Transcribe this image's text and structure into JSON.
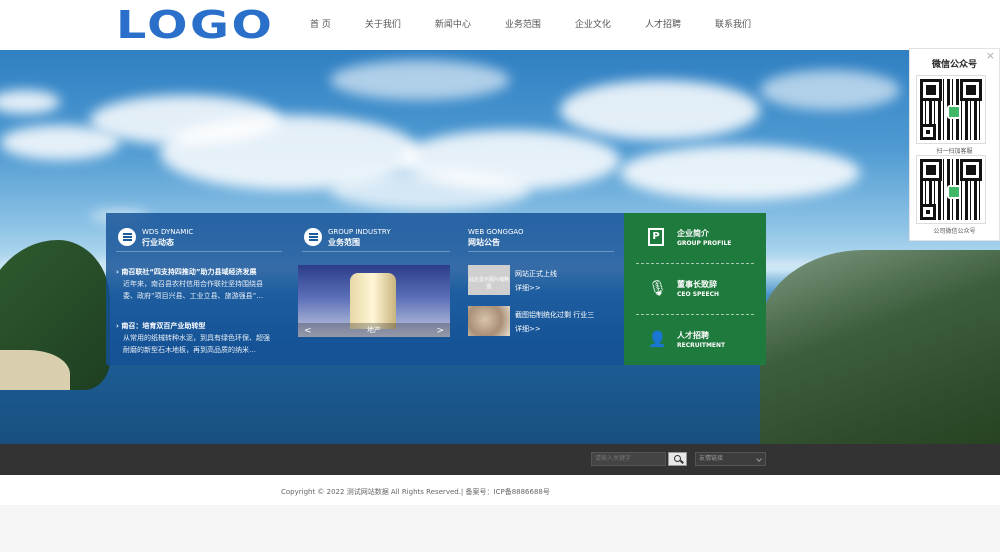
{
  "header": {
    "logo": "LOGO",
    "nav": [
      "首 页",
      "关于我们",
      "新闻中心",
      "业务范围",
      "企业文化",
      "人才招聘",
      "联系我们"
    ]
  },
  "panel": {
    "dynamic": {
      "en": "WDS DYNAMIC",
      "cn": "行业动态",
      "items": [
        {
          "title": "南召联社“四支持四推动”助力县域经济发展",
          "body": "近年来，南召县农村信用合作联社坚持围绕县委、政府“项目兴县、工业立县、旅游强县”…"
        },
        {
          "title": "南召：培育双百产业助转型",
          "body": "从常用的纸械转种水泥，到具有绿色环保、超强耐磨的新型石木地板，再到高品质的纳米…"
        }
      ]
    },
    "industry": {
      "en": "GROUP INDUSTRY",
      "cn": "业务范围",
      "slide_label": "地产",
      "prev": "<",
      "next": ">"
    },
    "notice": {
      "en": "WEB GONGGAO",
      "cn": "网站公告",
      "thumb_placeholder": "此处显示图片缩略图",
      "items": [
        {
          "title": "网站正式上线",
          "more": "详细>>"
        },
        {
          "title": "截图铝制统化过剩 行业三",
          "more": "详细>>"
        }
      ]
    }
  },
  "green": {
    "items": [
      {
        "cn": "企业简介",
        "en": "GROUP PROFILE",
        "icon": "P"
      },
      {
        "cn": "董事长致辞",
        "en": "CEO SPEECH",
        "icon": "🎙"
      },
      {
        "cn": "人才招聘",
        "en": "RECRUITMENT",
        "icon": "👤"
      }
    ]
  },
  "qr": {
    "title": "微信公众号",
    "close": "×",
    "caption1": "扫一扫加客服",
    "caption2": "公司微信公众号"
  },
  "bar": {
    "search_placeholder": "请输入关键字",
    "links": "友情链接"
  },
  "footer": {
    "copyright": "Copyright © 2022 测试网站数据 All Rights Reserved.| 备案号：ICP备8886688号"
  }
}
